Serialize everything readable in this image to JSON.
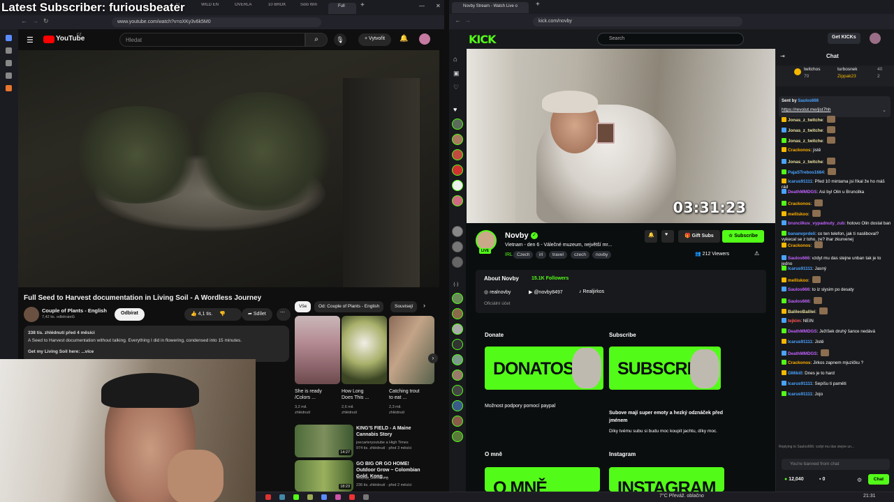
{
  "overlay": {
    "text": "Latest Subscriber: furiousbeater"
  },
  "left_browser": {
    "tabs": [
      "Fl",
      "WILD EN",
      "OVERLA",
      "10 BROK",
      "Solo Win",
      "Full"
    ],
    "url": "www.youtube.com/watch?v=oXKy3v6k5M0"
  },
  "youtube": {
    "logo": "YouTube",
    "region": "CZ",
    "search_placeholder": "Hledat",
    "create_label": "Vytvořit",
    "video_title": "Full Seed to Harvest documentation in Living Soil - A Wordless Journey",
    "channel": "Couple of Plants - English",
    "subscribers": "7,42 tis. odběratelů",
    "subscribe_label": "Odbírat",
    "likes": "4,1 tis.",
    "share_label": "Sdílet",
    "views_date": "338 tis. zhlédnutí  před 4 měsíci",
    "description": "A Seed to Harvest documentation without talking. Everything I did in flowering, condensed into 15 minutes.",
    "desc_link": "Get my Living Soil here:",
    "more_label": "...více",
    "chips": [
      "Vše",
      "Od: Couple of Plants - English",
      "Souvisejí"
    ],
    "shorts": [
      {
        "title": "She is ready /Colors ...",
        "views": "3,2 mil. zhlédnutí"
      },
      {
        "title": "How Long Does This ...",
        "views": "2,6 mil. zhlédnutí"
      },
      {
        "title": "Catching trout to eat ...",
        "views": "2,3 mil. zhlédnutí"
      }
    ],
    "related": [
      {
        "title": "KING'S FIELD - A Maine Cannabis Story",
        "channel": "joecarteryoutube a High Times",
        "meta": "974 tis. zhlédnutí · před 3 měsíci",
        "duration": "14:27"
      },
      {
        "title": "GO BIG OR GO HOME! Outdoor Grow ~ Colombian Gold, Kong ...",
        "channel": "Wepop_Gardening",
        "meta": "236 tis. zhlédnutí · před 2 měsíci",
        "duration": "18:23"
      }
    ]
  },
  "right_browser": {
    "tab_title": "Novby Stream - Watch Live o",
    "url": "kick.com/novby"
  },
  "kick": {
    "logo": "KICK",
    "search_placeholder": "Search",
    "get_kicks": "Get KICKs",
    "timer": "03:31:23",
    "streamer": "Novby",
    "live": "LIVE",
    "stream_title": "Vietnam - den 6 - Válečné muzeum, největší mr...",
    "category": "IRL",
    "tags": [
      "Czech",
      "irl",
      "travel",
      "czech",
      "novby"
    ],
    "viewers": "212 Viewers",
    "gift_subs": "Gift Subs",
    "subscribe": "Subscribe",
    "about_title": "About Novby",
    "followers": "15.1K Followers",
    "socials": [
      "realnovby",
      "@novby8497",
      "Realjirkos"
    ],
    "official": "Oficiální účet",
    "panels": [
      {
        "heading": "Donate",
        "banner": "DONATOSS",
        "caption": "Možnost podpory pomocí paypal"
      },
      {
        "heading": "Subscribe",
        "banner": "SUBSCRIBE",
        "caption": "Subove mají super emoty a hezký odznáček před jménem",
        "caption2": "Díky tvému subu si budu moc koupit jachtu, díky moc."
      },
      {
        "heading": "O mně",
        "banner": "O MNĚ",
        "caption": ""
      },
      {
        "heading": "Instagram",
        "banner": "INSTAGRAM",
        "caption": ""
      }
    ]
  },
  "chat": {
    "title": "Chat",
    "top_gifters": [
      {
        "name": "twitchos",
        "count": "70"
      },
      {
        "name": "turbosnek",
        "count": "40"
      },
      {
        "name": "Zippak23",
        "count": "2"
      }
    ],
    "pinned_sent_by": "Sent by",
    "pinned_user": "Saulos666",
    "pinned_link": "https://revolut.me/jist7hh",
    "messages": [
      {
        "user": "Jonas_z_twitche",
        "text": "",
        "color": "#e8e0a0"
      },
      {
        "user": "Jonas_z_twitche",
        "text": "",
        "color": "#e8e0a0"
      },
      {
        "user": "Jonas_z_twitche",
        "text": "",
        "color": "#e8e0a0"
      },
      {
        "user": "Crackonos",
        "text": "jistě",
        "color": "#ffb000"
      },
      {
        "user": "Jonas_z_twitche",
        "text": "",
        "color": "#e8e0a0"
      },
      {
        "user": "PajaSTrebos1684",
        "text": "",
        "color": "#4aa3ff"
      },
      {
        "user": "Icarus91111",
        "text": "Před 10 mintama jsi říkal že ho máš rád",
        "color": "#4aa3ff"
      },
      {
        "user": "DeathMMDGS",
        "text": "Asi byl Olin u Bruncilka",
        "color": "#c062ff"
      },
      {
        "user": "Crackonos",
        "text": "",
        "color": "#ffb000"
      },
      {
        "user": "melliskoo",
        "text": "",
        "color": "#ffb000"
      },
      {
        "user": "bruncilkuv_vypadnuty_zub",
        "text": "hotovo Olin dostal ban",
        "color": "#c062ff"
      },
      {
        "user": "bananvprdeli",
        "text": "co ten telefon, jak ti nasliboval? vykecal se z toho, ze? ihar zkurvenej",
        "color": "#4aa3ff"
      },
      {
        "user": "Crackonos",
        "text": "",
        "color": "#ffb000"
      },
      {
        "user": "Saulos666",
        "text": "vzdyt mu das stejne unban tak je to jedno",
        "color": "#c062ff"
      },
      {
        "user": "Icarus91111",
        "text": "Jasný",
        "color": "#4aa3ff"
      },
      {
        "user": "melliskoo",
        "text": "",
        "color": "#ffb000"
      },
      {
        "user": "Saulos666",
        "text": "to iz slysim po desaty",
        "color": "#c062ff"
      },
      {
        "user": "Saulos666",
        "text": "",
        "color": "#c062ff"
      },
      {
        "user": "BalileoBalilei",
        "text": "",
        "color": "#e8e0a0"
      },
      {
        "user": "tejkim",
        "text": "NEIN",
        "color": "#ff5555"
      },
      {
        "user": "DeathMMDGS",
        "text": "Ježíšek druhý šance nedává",
        "color": "#c062ff"
      },
      {
        "user": "Icarus91111",
        "text": "Jistě",
        "color": "#4aa3ff"
      },
      {
        "user": "DeathMMDGS",
        "text": "",
        "color": "#c062ff"
      },
      {
        "user": "Crackonos",
        "text": "Jirkos zapnem mjuzičku ?",
        "color": "#ffb000"
      },
      {
        "user": "GMiki0",
        "text": "Dnes je to hard",
        "color": "#4aa3ff"
      },
      {
        "user": "Icarus91111",
        "text": "Sepíšu ti paměti",
        "color": "#4aa3ff"
      },
      {
        "user": "Icarus91111",
        "text": "Jojo",
        "color": "#4aa3ff"
      }
    ],
    "replying_to": "Replying to Saulos666: vzdyt mu das stejne un...",
    "banned_placeholder": "You're banned from chat",
    "balance": "12,040",
    "kicks": "0",
    "chat_button": "Chat"
  },
  "taskbar": {
    "weather": "7°C  Převáž. oblačno",
    "time": "21:31"
  }
}
